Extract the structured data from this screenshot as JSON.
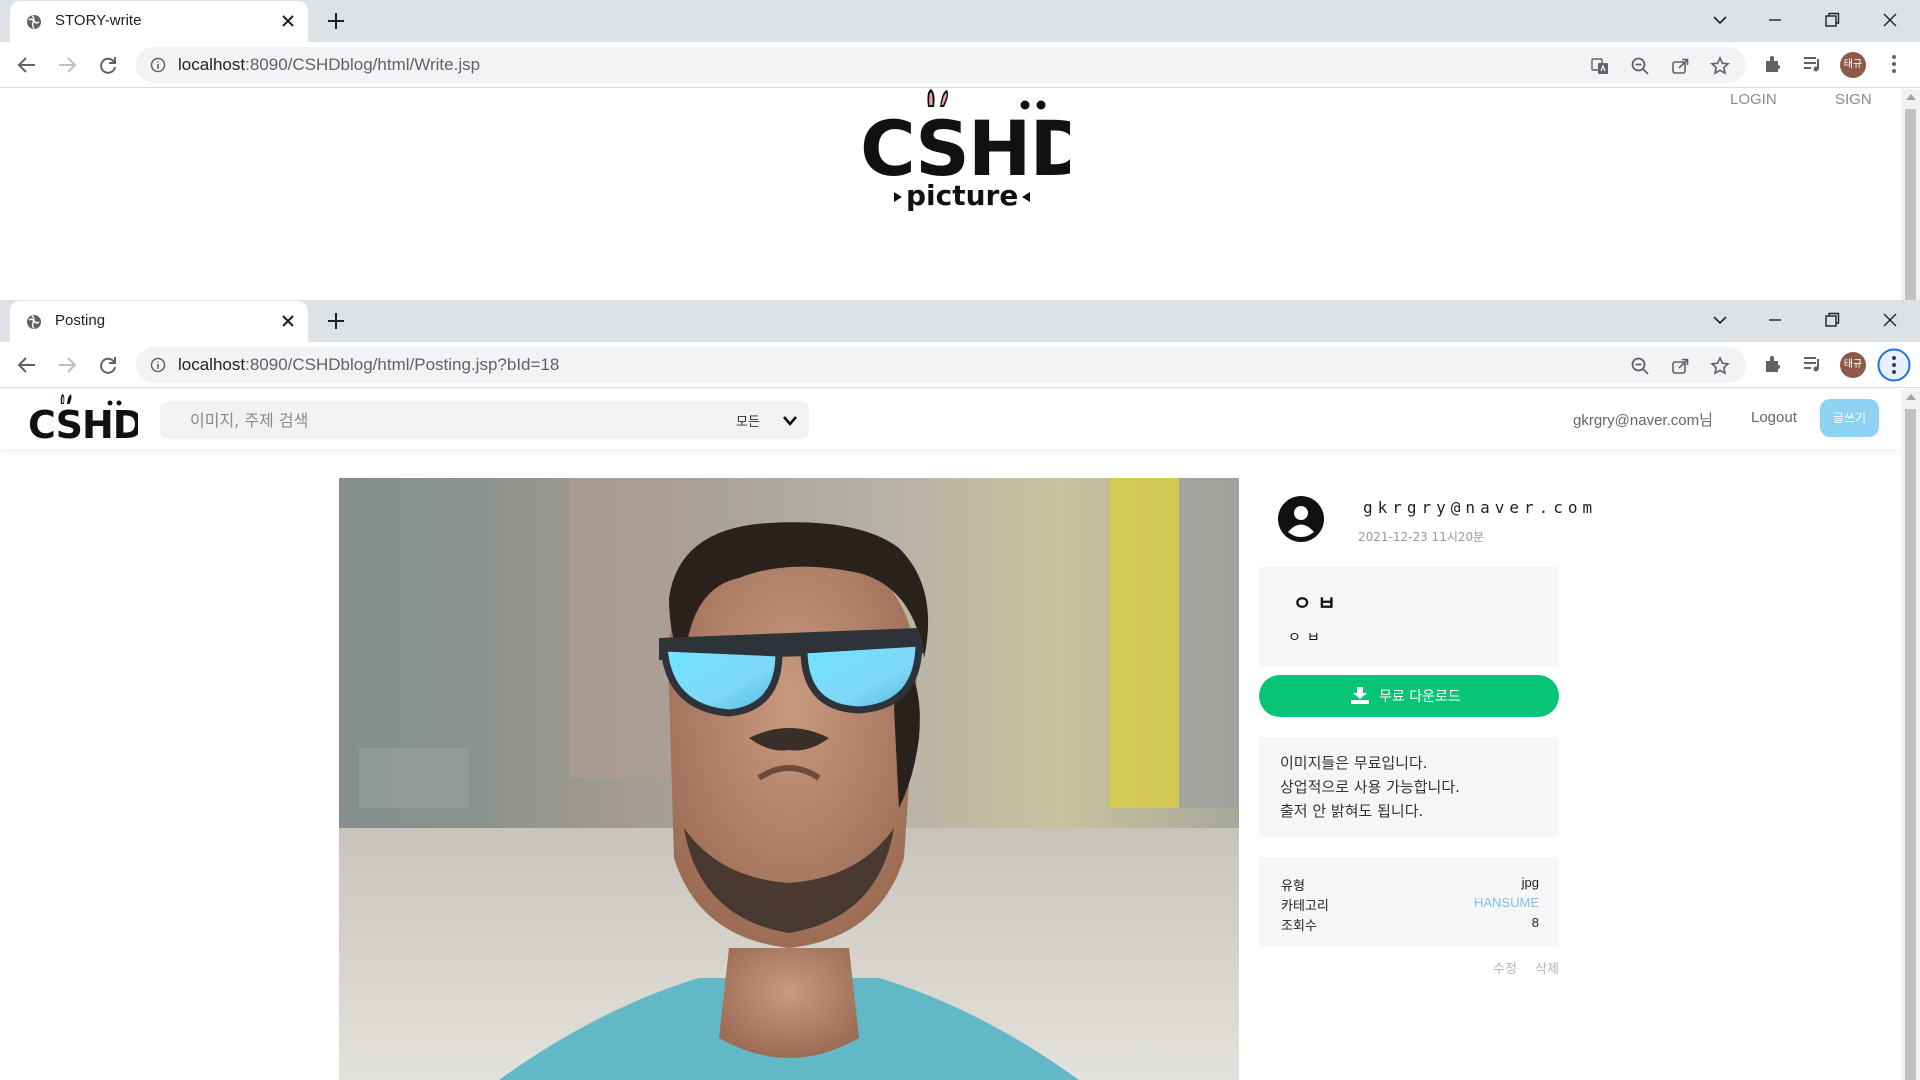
{
  "back_window": {
    "tab_title": "STORY-write",
    "url_host": "localhost",
    "url_path": ":8090/CSHDblog/html/Write.jsp",
    "avatar_text": "태규",
    "logo_main": "CSHD",
    "logo_sub": "picture",
    "nav_login": "LOGIN",
    "nav_sign": "SIGN"
  },
  "front_window": {
    "tab_title": "Posting",
    "url_host": "localhost",
    "url_path": ":8090/CSHDblog/html/Posting.jsp?bId=18",
    "avatar_text": "태규"
  },
  "header": {
    "logo_text": "CSHD",
    "search_placeholder": "이미지, 주제 검색",
    "search_scope": "모든",
    "user_email": "gkrgry@naver.com님",
    "logout_label": "Logout",
    "write_label": "글쓰기"
  },
  "post": {
    "author": "gkrgry@naver.com",
    "date": "2021-12-23 11시20분",
    "title": "ㅇㅂ",
    "body": "ㅇㅂ",
    "download_label": "무료 다운로드",
    "license_lines": [
      "이미지들은 무료입니다.",
      "상업적으로 사용 가능합니다.",
      "출저 안 밝혀도 됩니다."
    ],
    "meta": [
      {
        "label": "유형",
        "value": "jpg"
      },
      {
        "label": "카테고리",
        "value": "HANSUME"
      },
      {
        "label": "조회수",
        "value": "8"
      }
    ],
    "edit_label": "수정",
    "delete_label": "삭제"
  },
  "colors": {
    "download_green": "#08c476",
    "write_button": "#8fd3f4",
    "category_link": "#7ec3e6"
  }
}
